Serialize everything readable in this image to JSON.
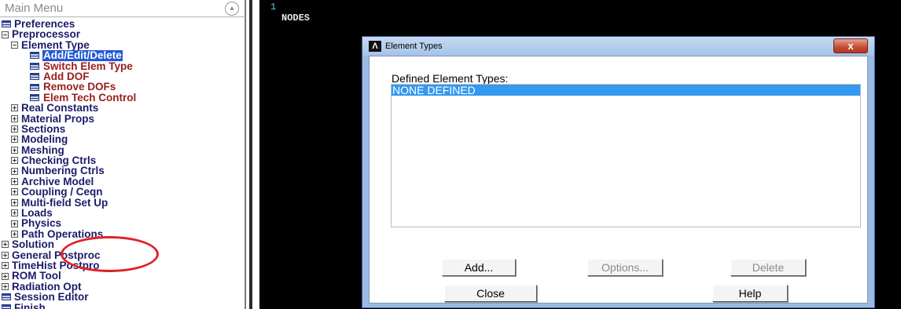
{
  "main_menu": {
    "title": "Main Menu",
    "items": [
      {
        "label": "Preferences",
        "level": 0,
        "kind": "doc"
      },
      {
        "label": "Preprocessor",
        "level": 0,
        "kind": "minus"
      },
      {
        "label": "Element Type",
        "level": 1,
        "kind": "minus"
      },
      {
        "label": "Add/Edit/Delete",
        "level": 3,
        "kind": "cmd",
        "selected": true
      },
      {
        "label": "Switch Elem Type",
        "level": 3,
        "kind": "cmd"
      },
      {
        "label": "Add DOF",
        "level": 3,
        "kind": "cmd"
      },
      {
        "label": "Remove DOFs",
        "level": 3,
        "kind": "cmd"
      },
      {
        "label": "Elem Tech Control",
        "level": 3,
        "kind": "cmd"
      },
      {
        "label": "Real Constants",
        "level": 1,
        "kind": "plus"
      },
      {
        "label": "Material Props",
        "level": 1,
        "kind": "plus"
      },
      {
        "label": "Sections",
        "level": 1,
        "kind": "plus"
      },
      {
        "label": "Modeling",
        "level": 1,
        "kind": "plus"
      },
      {
        "label": "Meshing",
        "level": 1,
        "kind": "plus"
      },
      {
        "label": "Checking Ctrls",
        "level": 1,
        "kind": "plus"
      },
      {
        "label": "Numbering Ctrls",
        "level": 1,
        "kind": "plus"
      },
      {
        "label": "Archive Model",
        "level": 1,
        "kind": "plus"
      },
      {
        "label": "Coupling / Ceqn",
        "level": 1,
        "kind": "plus"
      },
      {
        "label": "Multi-field Set Up",
        "level": 1,
        "kind": "plus"
      },
      {
        "label": "Loads",
        "level": 1,
        "kind": "plus"
      },
      {
        "label": "Physics",
        "level": 1,
        "kind": "plus"
      },
      {
        "label": "Path Operations",
        "level": 1,
        "kind": "plus"
      },
      {
        "label": "Solution",
        "level": 0,
        "kind": "plus"
      },
      {
        "label": "General Postproc",
        "level": 0,
        "kind": "plus"
      },
      {
        "label": "TimeHist Postpro",
        "level": 0,
        "kind": "plus"
      },
      {
        "label": "ROM Tool",
        "level": 0,
        "kind": "plus"
      },
      {
        "label": "Radiation Opt",
        "level": 0,
        "kind": "plus"
      },
      {
        "label": "Session Editor",
        "level": 0,
        "kind": "doc"
      },
      {
        "label": "Finish",
        "level": 0,
        "kind": "doc"
      }
    ]
  },
  "graphics": {
    "window_number": "1",
    "label": "NODES"
  },
  "dialog": {
    "title": "Element Types",
    "close_icon": "x",
    "defined_label": "Defined Element Types:",
    "list": [
      "NONE DEFINED"
    ],
    "buttons": {
      "add": "Add...",
      "options": "Options...",
      "delete": "Delete",
      "close": "Close",
      "help": "Help"
    }
  },
  "colors": {
    "menu_text": "#1b1b6a",
    "command_text": "#9b1c1c",
    "selection": "#2358d6",
    "list_selection": "#3399ee",
    "highlight_circle": "#e0202a"
  }
}
